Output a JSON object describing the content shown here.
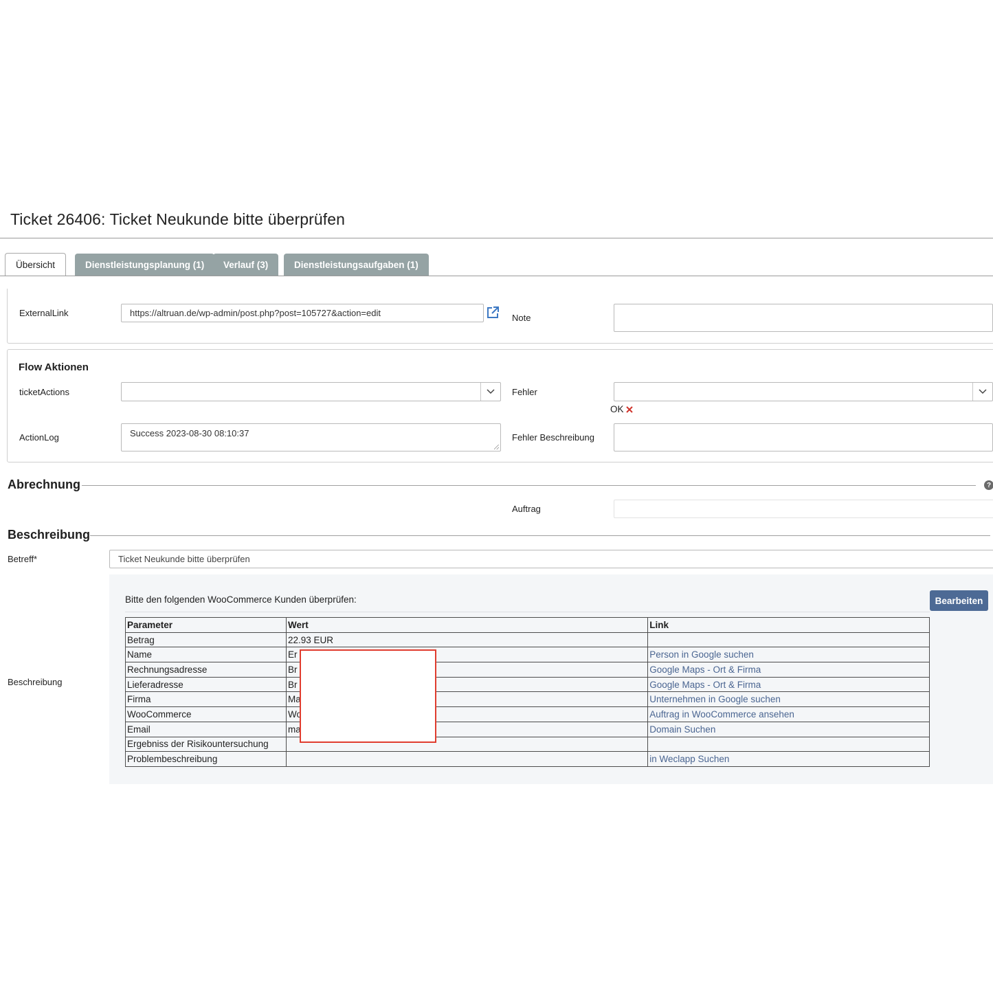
{
  "header": {
    "title": "Ticket 26406: Ticket Neukunde bitte überprüfen"
  },
  "tabs": [
    {
      "label": "Übersicht"
    },
    {
      "label": "Dienstleistungsplanung (1)"
    },
    {
      "label": "Verlauf (3)"
    },
    {
      "label": "Dienstleistungsaufgaben (1)"
    }
  ],
  "general": {
    "external_link_label": "ExternalLink",
    "external_link_value": "https://altruan.de/wp-admin/post.php?post=105727&action=edit",
    "note_label": "Note",
    "note_value": ""
  },
  "flow": {
    "title": "Flow Aktionen",
    "ticket_actions_label": "ticketActions",
    "ticket_actions_value": "",
    "fehler_label": "Fehler",
    "fehler_value": "",
    "ok_text": "OK",
    "action_log_label": "ActionLog",
    "action_log_value": "Success 2023-08-30 08:10:37",
    "fehler_beschreibung_label": "Fehler Beschreibung",
    "fehler_beschreibung_value": ""
  },
  "abrechnung": {
    "title": "Abrechnung",
    "auftrag_label": "Auftrag",
    "auftrag_value": ""
  },
  "beschreibung": {
    "title": "Beschreibung",
    "betreff_label": "Betreff*",
    "betreff_value": "Ticket Neukunde bitte überprüfen",
    "beschreibung_label": "Beschreibung",
    "intro": "Bitte den folgenden WooCommerce Kunden überprüfen:",
    "edit_button": "Bearbeiten",
    "table": {
      "headers": [
        "Parameter",
        "Wert",
        "Link"
      ],
      "rows": [
        [
          "Betrag",
          "22.93 EUR",
          ""
        ],
        [
          "Name",
          "Er",
          "Person in Google suchen"
        ],
        [
          "Rechnungsadresse",
          "Br",
          "Google Maps - Ort & Firma"
        ],
        [
          "Lieferadresse",
          "Br",
          "Google Maps - Ort & Firma"
        ],
        [
          "Firma",
          "Ma",
          "Unternehmen in Google suchen"
        ],
        [
          "WooCommerce",
          "Wo",
          "Auftrag in WooCommerce ansehen"
        ],
        [
          "Email",
          "ma",
          "Domain Suchen"
        ],
        [
          "Ergebniss der Risikountersuchung",
          "",
          ""
        ],
        [
          "Problembeschreibung",
          "",
          "in Weclapp Suchen"
        ]
      ]
    }
  },
  "colors": {
    "tab_inactive": "#95a3a4",
    "link": "#4a6591",
    "button": "#4d6a95",
    "error_x": "#d0342c",
    "redaction_border": "#e03c2e"
  }
}
